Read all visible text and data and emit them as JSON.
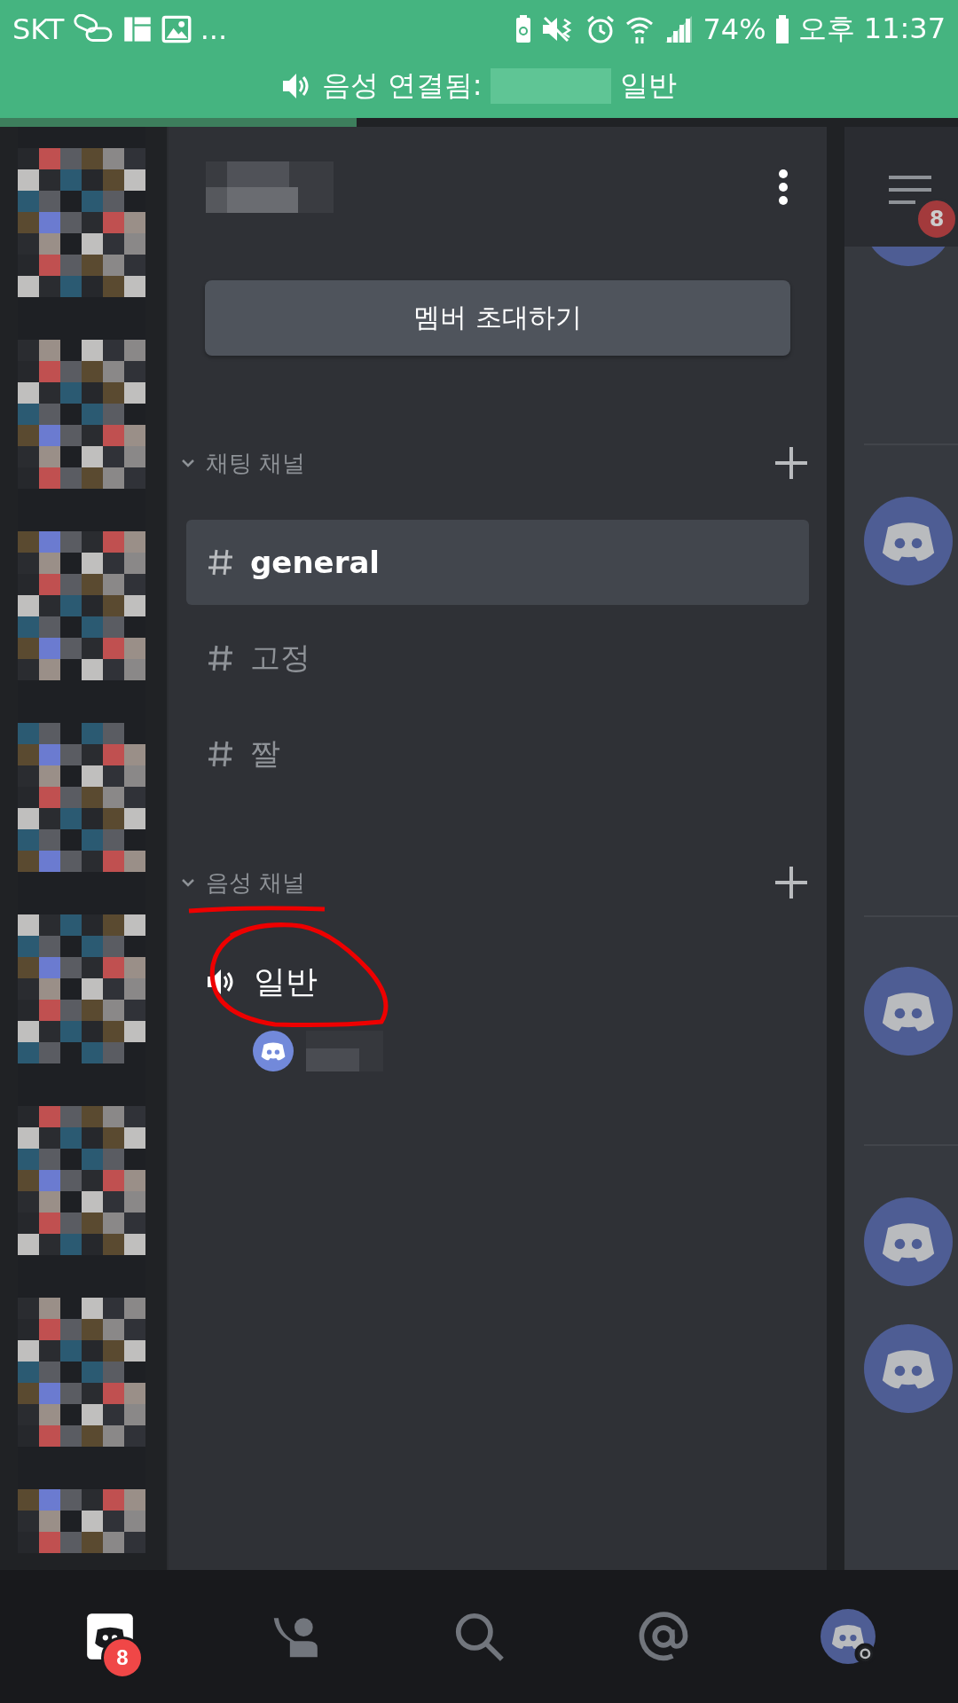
{
  "status_bar": {
    "carrier": "SKT",
    "more": "...",
    "battery": "74%",
    "time": "오후 11:37"
  },
  "voice_banner": {
    "label": "음성 연결됨:",
    "channel": "일반"
  },
  "server": {
    "invite_button": "멤버 초대하기"
  },
  "categories": [
    {
      "name": "채팅 채널",
      "expanded": true,
      "channels": [
        {
          "kind": "text",
          "name": "general",
          "selected": true
        },
        {
          "kind": "text",
          "name": "고정",
          "selected": false
        },
        {
          "kind": "text",
          "name": "짤",
          "selected": false
        }
      ]
    },
    {
      "name": "음성 채널",
      "expanded": true,
      "channels": [
        {
          "kind": "voice",
          "name": "일반",
          "selected": false,
          "users": [
            {
              "kind": "default-avatar"
            }
          ]
        }
      ]
    }
  ],
  "members_badge": "8",
  "bottom_nav": [
    {
      "kind": "home",
      "selected": true,
      "badge": "8"
    },
    {
      "kind": "friends",
      "selected": false
    },
    {
      "kind": "search",
      "selected": false
    },
    {
      "kind": "mentions",
      "selected": false
    },
    {
      "kind": "profile",
      "selected": false
    }
  ]
}
